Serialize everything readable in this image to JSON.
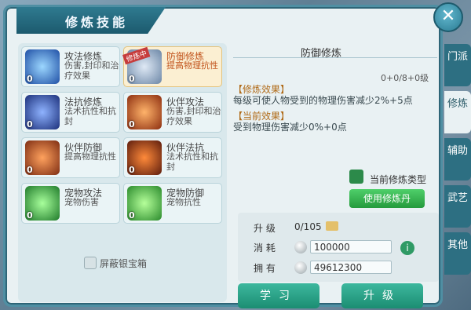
{
  "window": {
    "title": "修炼技能",
    "close_symbol": "✕"
  },
  "skills": [
    {
      "name": "攻法修炼",
      "desc": "伤害,封印和治疗效果",
      "level": "0",
      "selected": false
    },
    {
      "name": "防御修炼",
      "desc": "提高物理抗性",
      "level": "0",
      "selected": true,
      "badge": "修炼中"
    },
    {
      "name": "法抗修炼",
      "desc": "法术抗性和抗封",
      "level": "0",
      "selected": false
    },
    {
      "name": "伙伴攻法",
      "desc": "伤害,封印和治疗效果",
      "level": "0",
      "selected": false
    },
    {
      "name": "伙伴防御",
      "desc": "提高物理抗性",
      "level": "0",
      "selected": false
    },
    {
      "name": "伙伴法抗",
      "desc": "法术抗性和抗封",
      "level": "0",
      "selected": false
    },
    {
      "name": "宠物攻法",
      "desc": "宠物伤害",
      "level": "0",
      "selected": false
    },
    {
      "name": "宠物防御",
      "desc": "宠物抗性",
      "level": "0",
      "selected": false
    }
  ],
  "mask_box": {
    "label": "屏蔽银宝箱"
  },
  "detail": {
    "header": "防御修炼",
    "level": "0+0/8+0级",
    "effect_title": "【修炼效果】",
    "effect_text": "每级可使人物受到的物理伤害减少2%+5点",
    "current_title": "【当前效果】",
    "current_text": "受到物理伤害减少0%+0点",
    "current_type_label": "当前修炼类型",
    "use_pill_button": "使用修炼丹"
  },
  "upgrade": {
    "level_label": "升 级",
    "level_value": "0/105",
    "cost_label": "消 耗",
    "cost_value": "100000",
    "own_label": "拥 有",
    "own_value": "49612300",
    "info_symbol": "i"
  },
  "buttons": {
    "learn": "学习",
    "upgrade": "升级"
  },
  "side_tabs": [
    {
      "label": "门派",
      "active": false
    },
    {
      "label": "修炼",
      "active": true
    },
    {
      "label": "辅助",
      "active": false
    },
    {
      "label": "武艺",
      "active": false
    },
    {
      "label": "其他",
      "active": false
    }
  ],
  "colors": {
    "accent": "#2d6f82",
    "highlight": "#c2541c",
    "button_green": "#249a3c",
    "button_teal": "#1b8d72"
  },
  "icons": [
    "attack-magic-icon",
    "defense-shield-icon",
    "magic-resist-icon",
    "partner-attack-icon",
    "partner-defense-icon",
    "partner-resist-icon",
    "pet-attack-icon",
    "pet-defense-icon"
  ]
}
